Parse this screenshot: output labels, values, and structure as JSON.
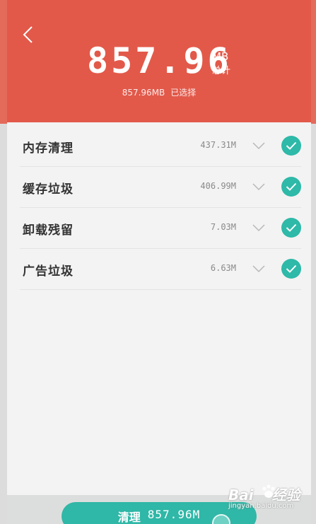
{
  "header": {
    "total_amount": "857.96",
    "unit": "MB",
    "unit_caption": "总计",
    "selected_amount": "857.96MB",
    "selected_label": "已选择"
  },
  "items": [
    {
      "label": "内存清理",
      "size": "437.31M",
      "checked": true
    },
    {
      "label": "缓存垃圾",
      "size": "406.99M",
      "checked": true
    },
    {
      "label": "卸载残留",
      "size": "7.03M",
      "checked": true
    },
    {
      "label": "广告垃圾",
      "size": "6.63M",
      "checked": true
    }
  ],
  "clean_button": {
    "label": "清理",
    "amount": "857.96M"
  },
  "watermark": {
    "brand": "Bai",
    "brand_suffix": "经验",
    "url": "jingyan.baidu.com"
  },
  "colors": {
    "header_bg": "#e2594a",
    "accent": "#2eb9a8"
  }
}
